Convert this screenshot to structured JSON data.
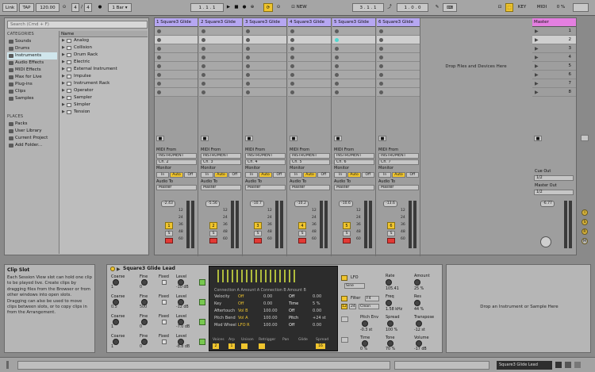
{
  "toolbar": {
    "link": "Link",
    "tap": "TAP",
    "tempo": "120.00",
    "sig_num": "4",
    "sig_sep": "/",
    "sig_den": "4",
    "quantize": "1 Bar",
    "position": "1 . 1 . 1",
    "new_label": "NEW",
    "loop_start": "3 . 1 . 1",
    "loop_len": "1 . 0 . 0",
    "key_label": "KEY",
    "midi_label": "MIDI",
    "cpu": "0 %"
  },
  "browser": {
    "search_placeholder": "Search (Cmd + F)",
    "categories_header": "CATEGORIES",
    "categories": [
      "Sounds",
      "Drums",
      "Instruments",
      "Audio Effects",
      "MIDI Effects",
      "Max for Live",
      "Plug-ins",
      "Clips",
      "Samples"
    ],
    "selected_category": "Instruments",
    "places_header": "PLACES",
    "places": [
      "Packs",
      "User Library",
      "Current Project",
      "Add Folder..."
    ],
    "name_header": "Name",
    "items": [
      "Analog",
      "Collision",
      "Drum Rack",
      "Electric",
      "External Instrument",
      "Impulse",
      "Instrument Rack",
      "Operator",
      "Sampler",
      "Simpler",
      "Tension"
    ]
  },
  "tracks": [
    {
      "title": "1 Square3 Glide",
      "input": "INSTRUMENT",
      "channel": "Ch. 2",
      "volume": "-2.43",
      "number": "1"
    },
    {
      "title": "2 Square3 Glide",
      "input": "INSTRUMENT",
      "channel": "Ch. 3",
      "volume": "-5.56",
      "number": "2"
    },
    {
      "title": "3 Square3 Glide",
      "input": "INSTRUMENT",
      "channel": "Ch. 4",
      "volume": "-10.7",
      "number": "3"
    },
    {
      "title": "4 Square3 Glide",
      "input": "INSTRUMENT",
      "channel": "Ch. 5",
      "volume": "-10.2",
      "number": "4"
    },
    {
      "title": "5 Square3 Glide",
      "input": "INSTRUMENT",
      "channel": "Ch. 6",
      "volume": "-10.6",
      "number": "5"
    },
    {
      "title": "6 Square3 Glide",
      "input": "INSTRUMENT",
      "channel": "Ch. 7",
      "volume": "-13.6",
      "number": "6"
    }
  ],
  "io_labels": {
    "midi_from": "MIDI From",
    "monitor": "Monitor",
    "in": "In",
    "auto": "Auto",
    "off": "Off",
    "audio_to": "Audio To",
    "master_out": "Master",
    "solo": "S"
  },
  "meter_scale": [
    "12",
    "24",
    "36",
    "48",
    "60"
  ],
  "session": {
    "drop_text": "Drop Files and Devices Here"
  },
  "master": {
    "title": "Master",
    "scenes": [
      "1",
      "2",
      "3",
      "4",
      "5",
      "6",
      "7",
      "8"
    ],
    "cue_out": "Cue Out",
    "cue_val": "1/2",
    "master_out": "Master Out",
    "master_val": "1/2",
    "volume": "-6.77"
  },
  "info": {
    "title": "Clip Slot",
    "text": "Each Session View slot can hold one clip to be played live. Create clips by dragging files from the Browser or from other windows into open slots. Dragging can also be used to move clips between slots, or to copy clips in from the Arrangement."
  },
  "device": {
    "name": "Square3 Glide Lead",
    "osc_rows": [
      {
        "coarse": "Coarse",
        "fine": "Fine",
        "fixed": "Fixed",
        "level": "Level",
        "v_coarse": "1",
        "v_fine": "0",
        "v_level": "-10 dB"
      },
      {
        "coarse": "Coarse",
        "fine": "Fine",
        "fixed": "Fixed",
        "level": "Level",
        "v_coarse": "0.5",
        "v_fine": "500",
        "v_level": "-12 dB"
      },
      {
        "coarse": "Coarse",
        "fine": "Fine",
        "fixed": "Fixed",
        "level": "Level",
        "v_coarse": "1",
        "v_fine": "0",
        "v_level": "-7.0 dB"
      },
      {
        "coarse": "Coarse",
        "fine": "Fine",
        "fixed": "Fixed",
        "level": "Level",
        "v_coarse": "1",
        "v_fine": "0",
        "v_level": "-8.8 dB"
      }
    ],
    "mod_header": "Connection A Amount A Connection B Amount B",
    "mod_rows": [
      {
        "a": "Velocity",
        "b": "Off",
        "c": "0.00",
        "d": "Off",
        "e": "0.00"
      },
      {
        "a": "Key",
        "b": "Off",
        "c": "0.00",
        "d": "Time",
        "e": "5 %"
      },
      {
        "a": "Aftertouch",
        "b": "Vol B",
        "c": "100.00",
        "d": "Off",
        "e": "0.00"
      },
      {
        "a": "Pitch Bend",
        "b": "Vol A",
        "c": "100.00",
        "d": "Pitch",
        "e": "+24 st"
      },
      {
        "a": "Mod Wheel",
        "b": "LFO R",
        "c": "100.00",
        "d": "Off",
        "e": "0.00"
      }
    ],
    "mod_bottom": [
      "Voices",
      "Arp",
      "Unison",
      "Retrigger",
      "Pan",
      "Glide",
      "Spread"
    ],
    "mod_bottom_vals": [
      "2",
      "1",
      "16"
    ],
    "lfo": "LFO",
    "lfo_wave": "Sine",
    "rate_label": "Rate",
    "rate_val": "105.41",
    "amount_label": "Amount",
    "amount_val": "25 %",
    "filter": "Filter",
    "filter_type": "Clean",
    "filter_mode": "F4",
    "freq_label": "Freq",
    "freq_val": "1.58 kHz",
    "res_label": "Res",
    "res_val": "44 %",
    "pitch_env": "Pitch Env",
    "pitch_env_val": "-0.3 st",
    "spread_label": "Spread",
    "spread_val": "100 %",
    "transpose_label": "Transpose",
    "transpose_val": "-12 st",
    "time_label": "Time",
    "time_val": "0 %",
    "tone_label": "Tone",
    "tone_val": "70 %",
    "volume_label": "Volume",
    "volume_val": "-17 dB",
    "btn_12": "12",
    "btn_24": "24"
  },
  "drop2": {
    "text": "Drop an Instrument or Sample Here"
  },
  "status": {
    "device_name": "Square3 Glide Lead"
  }
}
